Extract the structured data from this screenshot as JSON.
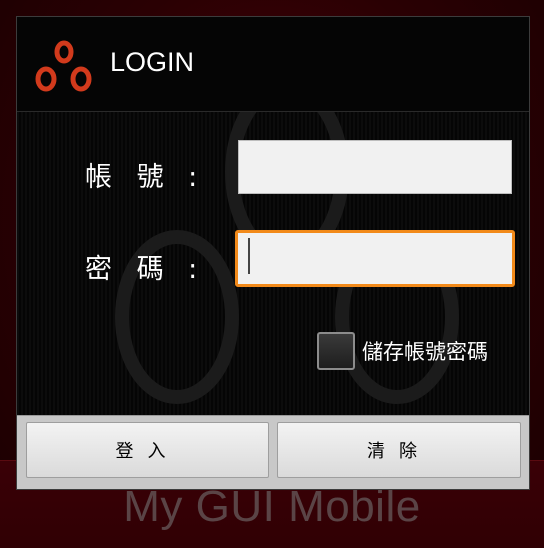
{
  "app": {
    "brand": "My GUI Mobile"
  },
  "dialog": {
    "title": "LOGIN",
    "logo_icon": "three-circles-logo-icon",
    "account_label": "帳 號 :",
    "password_label": "密 碼 :",
    "account_value": "",
    "password_value": "",
    "remember_label": "儲存帳號密碼",
    "remember_checked": false,
    "login_button": "登入",
    "clear_button": "清除"
  },
  "colors": {
    "accent_focus": "#f28a1a",
    "logo_red": "#d23a1c",
    "background_red": "#3a0006"
  }
}
